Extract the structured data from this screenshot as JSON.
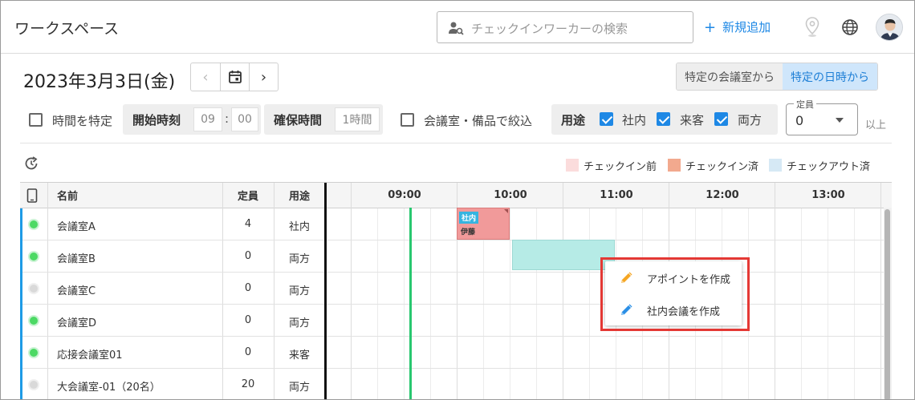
{
  "header": {
    "workspace_title": "ワークスペース",
    "search_placeholder": "チェックインワーカーの検索",
    "new_label": "新規追加",
    "plus_glyph": "+"
  },
  "date_bar": {
    "date": "2023年3月3日(金)",
    "prev_glyph": "‹",
    "next_glyph": "›",
    "mode_room": "特定の会議室から",
    "mode_datetime": "特定の日時から",
    "active_mode": "mode_datetime"
  },
  "filters": {
    "time_specify_label": "時間を特定",
    "start_time_label": "開始時刻",
    "start_hour": "09",
    "time_sep": ":",
    "start_min": "00",
    "duration_label": "確保時間",
    "duration_value": "1時間",
    "facility_label": "会議室・備品で絞込",
    "purpose_label": "用途",
    "purpose_internal": "社内",
    "purpose_visitor": "来客",
    "purpose_both": "両方",
    "capacity_label": "定員",
    "capacity_value": "0",
    "capacity_suffix": "以上"
  },
  "legend": [
    {
      "label": "チェックイン前",
      "color": "#fbdcdc"
    },
    {
      "label": "チェックイン済",
      "color": "#f2a98e"
    },
    {
      "label": "チェックアウト済",
      "color": "#d6e9f5"
    }
  ],
  "table": {
    "col_name": "名前",
    "col_capacity": "定員",
    "col_usage": "用途",
    "hours": [
      "09:00",
      "10:00",
      "11:00",
      "12:00",
      "13:00"
    ],
    "rows": [
      {
        "name": "会議室A",
        "capacity": "4",
        "usage": "社内",
        "active": true
      },
      {
        "name": "会議室B",
        "capacity": "0",
        "usage": "両方",
        "active": true
      },
      {
        "name": "会議室C",
        "capacity": "0",
        "usage": "両方",
        "active": false
      },
      {
        "name": "会議室D",
        "capacity": "0",
        "usage": "両方",
        "active": true
      },
      {
        "name": "応接会議室01",
        "capacity": "0",
        "usage": "来客",
        "active": true
      },
      {
        "name": "大会議室-01（20名）",
        "capacity": "20",
        "usage": "両方",
        "active": false
      }
    ]
  },
  "appointment": {
    "tag": "社内",
    "person": "伊藤"
  },
  "context_menu": {
    "create_appointment": "アポイントを作成",
    "create_internal_meeting": "社内会議を作成"
  },
  "colors": {
    "accent": "#1e88e5",
    "status_active": "#4cd964",
    "status_inactive": "#d9d9d9",
    "current_time_line": "#28c76f",
    "highlight_outline": "#e53935"
  }
}
